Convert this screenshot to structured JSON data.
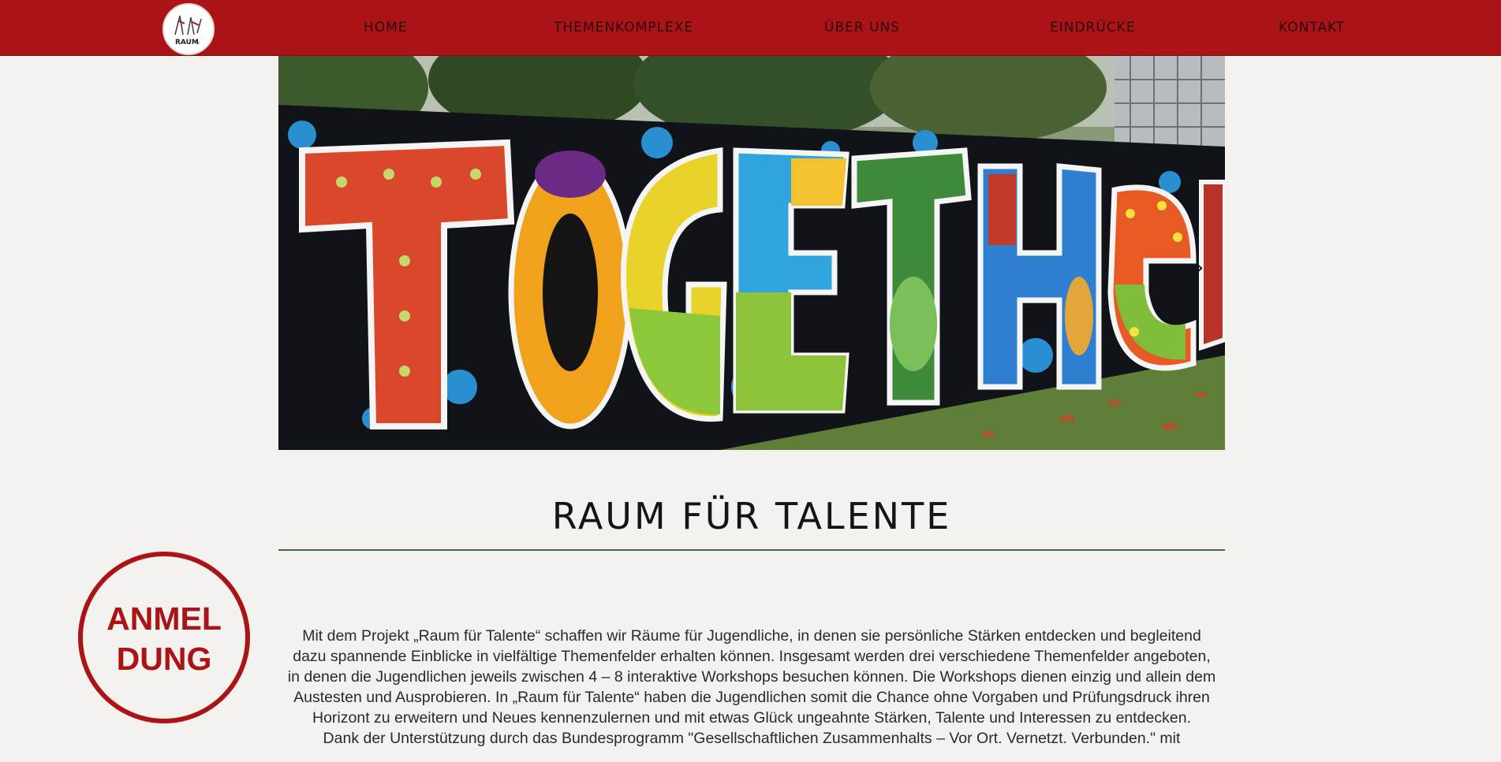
{
  "header": {
    "logo_alt": "Raum für Talente logo",
    "nav": [
      {
        "label": "Home"
      },
      {
        "label": "Themenkomplexe"
      },
      {
        "label": "Über uns"
      },
      {
        "label": "Eindrücke"
      },
      {
        "label": "Kontakt"
      }
    ]
  },
  "slider": {
    "image_description": "Graffiti mural spelling TOGETHER",
    "prev_icon": "chevron-left-icon",
    "next_icon": "chevron-right-icon"
  },
  "main": {
    "heading": "Raum für Talente",
    "registration_badge": [
      "ANMEL",
      "DUNG"
    ],
    "intro_paragraphs": [
      "Mit dem Projekt „Raum für Talente“ schaffen wir Räume für Jugendliche, in denen sie persönliche Stärken entdecken und begleitend dazu spannende Einblicke in vielfältige Themenfelder erhalten können. Insgesamt werden drei verschiedene Themenfelder angeboten, in denen die Jugendlichen jeweils zwischen 4 – 8 interaktive Workshops besuchen können. Die Workshops dienen einzig und allein dem Austesten und Ausprobieren. In „Raum für Talente“ haben die Jugendlichen somit die Chance ohne Vorgaben und Prüfungsdruck ihren Horizont zu erweitern und Neues kennenzulernen und mit etwas Glück ungeahnte Stärken, Talente und Interessen zu entdecken.",
      "Dank der Unterstützung durch das Bundesprogramm \"Gesellschaftlichen Zusammenhalts – Vor Ort. Vernetzt. Verbunden.\" mit"
    ]
  },
  "colors": {
    "brand_red": "#ab1417",
    "background": "#f4f2ee",
    "rule_green": "#3f6b4d"
  }
}
